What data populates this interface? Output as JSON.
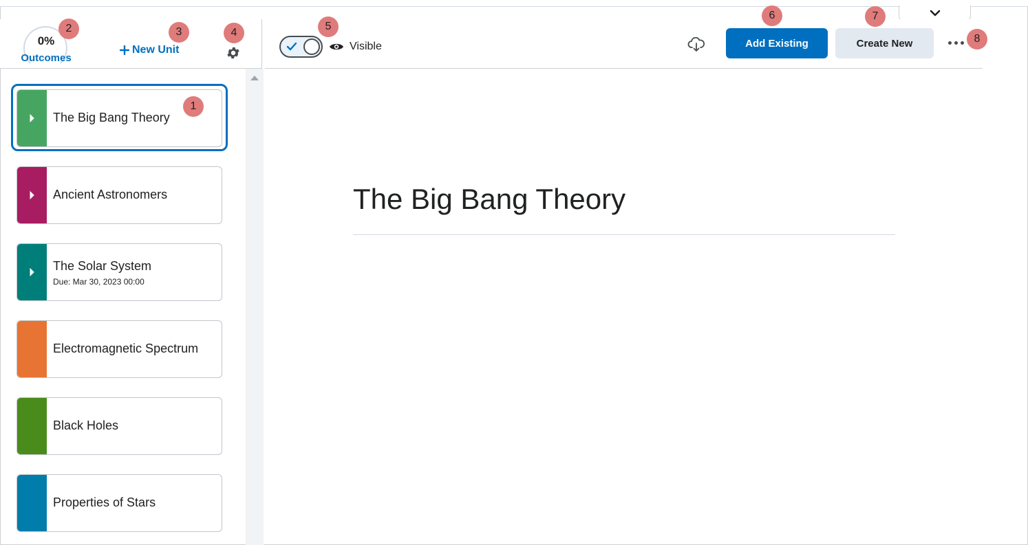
{
  "left_header": {
    "outcomes_percent": "0%",
    "outcomes_label": "Outcomes",
    "new_unit_label": "New Unit"
  },
  "units": [
    {
      "title": "The Big Bang Theory",
      "due": "",
      "color": "#46a661",
      "has_arrow": true
    },
    {
      "title": "Ancient Astronomers",
      "due": "",
      "color": "#a81c62",
      "has_arrow": true
    },
    {
      "title": "The Solar System",
      "due": "Due: Mar 30, 2023 00:00",
      "color": "#007f7a",
      "has_arrow": true
    },
    {
      "title": "Electromagnetic Spectrum",
      "due": "",
      "color": "#e87433",
      "has_arrow": false
    },
    {
      "title": "Black Holes",
      "due": "",
      "color": "#4a8c1c",
      "has_arrow": false
    },
    {
      "title": "Properties of Stars",
      "due": "",
      "color": "#007daa",
      "has_arrow": false
    }
  ],
  "toolbar": {
    "visibility_label": "Visible",
    "add_existing_label": "Add Existing",
    "create_new_label": "Create New"
  },
  "content": {
    "title": "The Big Bang Theory"
  },
  "callouts": [
    "1",
    "2",
    "3",
    "4",
    "5",
    "6",
    "7",
    "8"
  ],
  "colors": {
    "accent": "#006fbf",
    "callout": "#e07b7b",
    "secondary_button": "#e3e9f1"
  },
  "icons": {
    "outcomes": "progress-ring-icon",
    "new_unit": "plus-icon",
    "settings": "gear-icon",
    "toggle": "checkmark-icon",
    "visibility": "eye-icon",
    "download": "cloud-download-icon",
    "more": "more-options-icon",
    "dropdown": "chevron-down-icon",
    "unit_expand": "caret-right-icon"
  }
}
